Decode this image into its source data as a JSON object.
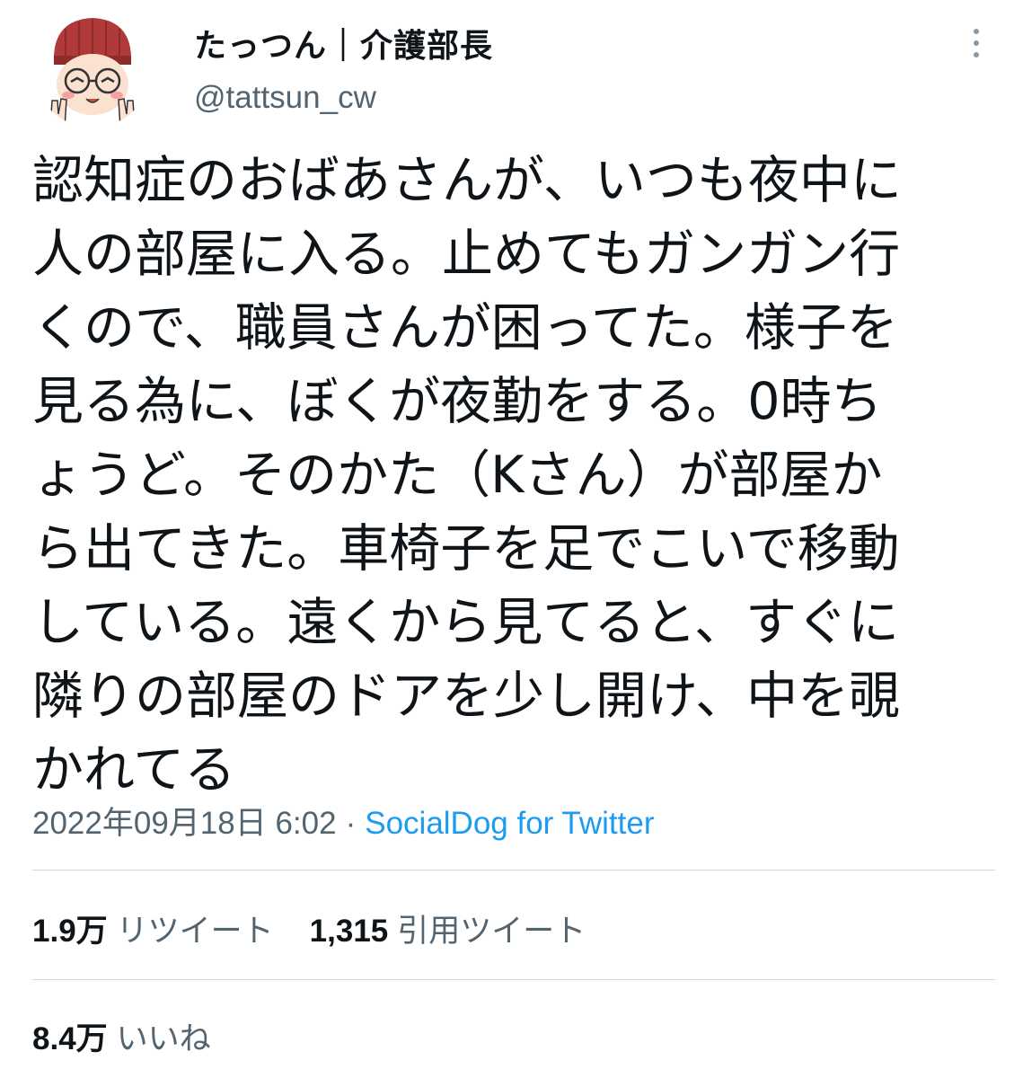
{
  "user": {
    "display_name": "たっつん｜介護部長",
    "handle": "@tattsun_cw"
  },
  "tweet": {
    "lines": [
      "認知症のおばあさんが、いつも夜中に",
      "人の部屋に入る。止めてもガンガン行",
      "くので、職員さんが困ってた。様子を",
      "見る為に、ぼくが夜勤をする。0時ち",
      "ょうど。そのかた（Kさん）が部屋か",
      "ら出てきた。車椅子を足でこいで移動",
      "している。遠くから見てると、すぐに",
      "隣りの部屋のドアを少し開け、中を覗",
      "かれてる"
    ],
    "timestamp": "2022年09月18日 6:02",
    "separator": "·",
    "source": "SocialDog for Twitter"
  },
  "stats": {
    "retweets_count": "1.9万",
    "retweets_label": "リツイート",
    "quotes_count": "1,315",
    "quotes_label": "引用ツイート",
    "likes_count": "8.4万",
    "likes_label": "いいね"
  },
  "icons": {
    "avatar": "avatar-illustration",
    "more": "more-options-icon"
  },
  "colors": {
    "text": "#0f1419",
    "secondary": "#536471",
    "link": "#1d9bf0",
    "divider": "#cfd9de"
  }
}
